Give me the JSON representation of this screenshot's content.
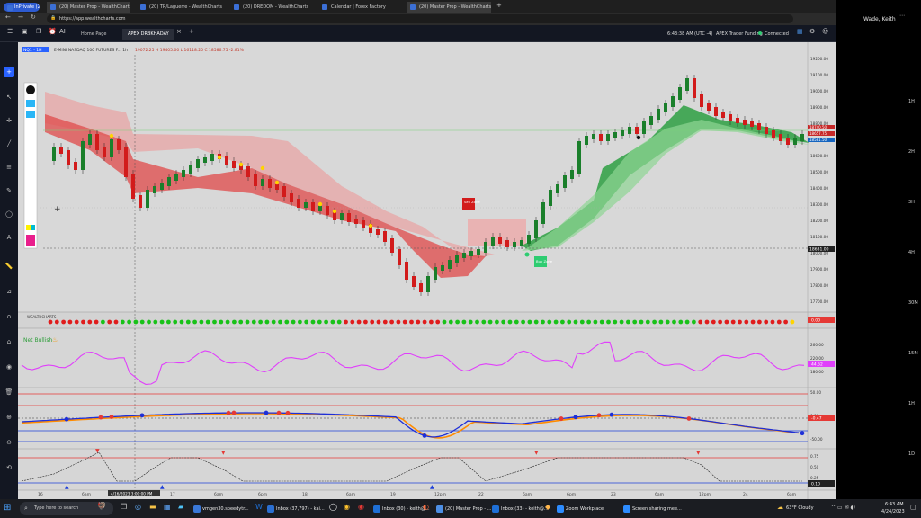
{
  "browser": {
    "profile_label": "InPrivate (2)",
    "tabs": [
      {
        "label": "(20) Master Prop - WealthCharts"
      },
      {
        "label": "(20) TR/Laguerre - WealthCharts"
      },
      {
        "label": "(20) DREDOM - WealthCharts"
      },
      {
        "label": "Calendar | Forex Factory"
      },
      {
        "label": "(20) Master Prop - WealthCharts"
      }
    ],
    "url": "https://app.wealthcharts.com"
  },
  "app": {
    "tabs": [
      {
        "label": "Home Page"
      },
      {
        "label": "APEX DRBKHADAY"
      }
    ],
    "clock": "6:43:38 AM",
    "tz": "(UTC -4)",
    "account": "APEX Trader Funding",
    "connection": "Connected",
    "connection_color": "#2ecc71"
  },
  "zoom_panel": {
    "name": "Wade, Keith"
  },
  "chart": {
    "symbol_tag": "NQ1 - 1H",
    "symbol_title": "E-MINI NASDAQ 100 FUTURES F... 1h",
    "ohlc_readout": "19072.25 H 19405.00 L 16118.25 C 18586.75 -2.81%",
    "last_price": "18631.00",
    "right_tags": [
      "18740.50",
      "18657.75",
      "18581.50"
    ],
    "up_color": "#1a7f2b",
    "down_color": "#d21b1b",
    "y_ticks": [
      "19200.00",
      "19100.00",
      "19000.00",
      "18900.00",
      "18800.00",
      "18700.00",
      "18600.00",
      "18500.00",
      "18400.00",
      "18300.00",
      "18200.00",
      "18100.00",
      "18000.00",
      "17900.00",
      "17800.00",
      "17700.00"
    ],
    "time_ticks": [
      "16",
      "6am",
      "6pm",
      "17",
      "6am",
      "6pm",
      "18",
      "6am",
      "19",
      "12pm",
      "22",
      "6am",
      "6pm",
      "23",
      "6am",
      "12pm",
      "24",
      "6am"
    ],
    "crosshair_date": "4/16/2023 3:00:00 PM",
    "sell_label": "Sell\nZone",
    "buy_label": "Buy\nZone",
    "dots_label": "WEALTHCHARTS",
    "dots_value": "0.00",
    "net_bullish": "Net Bullish",
    "osc1_value": "44.52",
    "osc1_ticks": [
      "260.00",
      "220.00",
      "180.00"
    ],
    "osc2_value": "-0.47",
    "osc2_ticks": [
      "50.00",
      "0.00",
      "-50.00"
    ],
    "osc3_value": "0.10",
    "osc3_ticks": [
      "0.75",
      "0.50",
      "0.25"
    ],
    "right_axis_labels": [
      "1H",
      "2H",
      "3H",
      "4H",
      "30M",
      "15M",
      "1H",
      "1D"
    ]
  },
  "taskbar": {
    "search_placeholder": "Type here to search",
    "items": [
      {
        "label": "vmgen30.speedytr...",
        "color": "#3a78d8"
      },
      {
        "label": "Inbox (37,797) - kai...",
        "color": "#2b6fd1"
      },
      {
        "label": "Inbox (30) - keith@...",
        "color": "#1e6fd6"
      },
      {
        "label": "(20) Master Prop - ...",
        "color": "#4d8fe5"
      },
      {
        "label": "Inbox (33) - keith@...",
        "color": "#1e6fd6"
      },
      {
        "label": "Zoom Workplace",
        "color": "#2d8cff"
      },
      {
        "label": "Screen sharing mee...",
        "color": "#2d8cff"
      }
    ],
    "weather": "63°F  Cloudy",
    "time": "6:43 AM",
    "date": "4/24/2023"
  }
}
